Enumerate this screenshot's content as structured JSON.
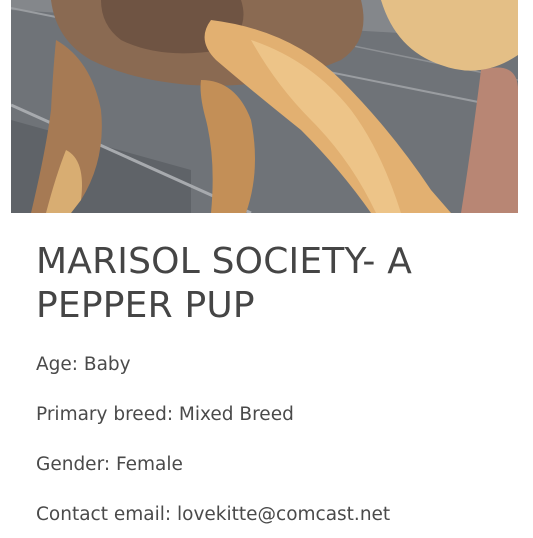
{
  "pet": {
    "name": "MARISOL SOCIETY- A PEPPER PUP",
    "photo_icon": "dog-photo",
    "details": {
      "age": "Age: Baby",
      "breed": "Primary breed: Mixed Breed",
      "gender": "Gender: Female",
      "contact": "Contact email: lovekitte@comcast.net"
    }
  },
  "colors": {
    "text": "#4a4a4a",
    "title": "#454545",
    "floor": "#7c7f84",
    "fur": "#c9955e"
  }
}
